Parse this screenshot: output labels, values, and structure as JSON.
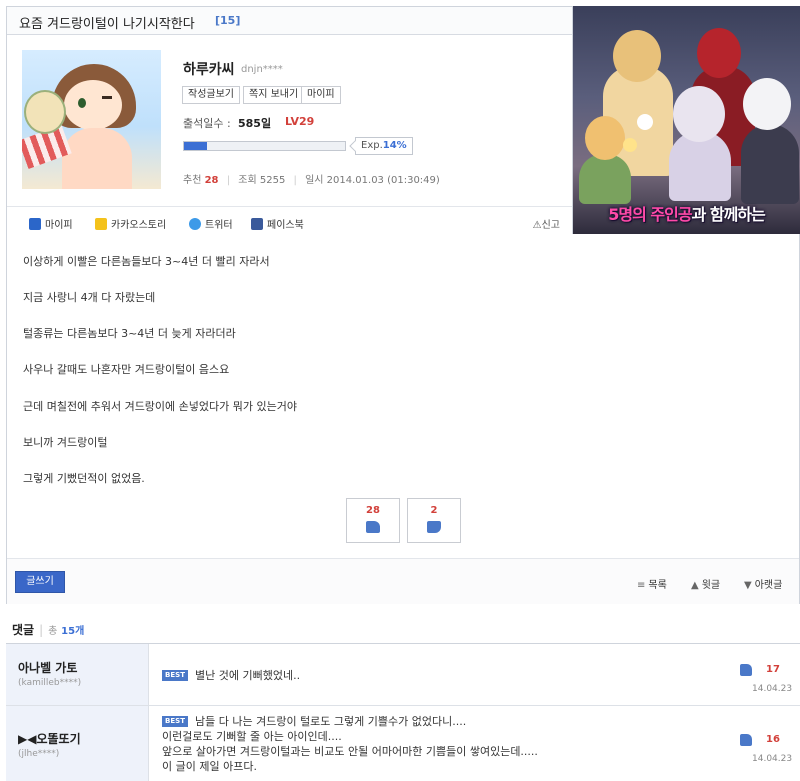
{
  "post": {
    "title": "요즘 겨드랑이털이 나기시작한다",
    "comment_count_badge": "[15]",
    "author": {
      "name": "하루카씨",
      "id": "dnjn****",
      "buttons": [
        "작성글보기",
        "쪽지 보내기",
        "마이피"
      ],
      "attendance_label": "출석일수 :",
      "attendance_value": "585일",
      "level": "LV29",
      "exp_label": "Exp.",
      "exp_percent": "14%",
      "exp_fraction": 0.14
    },
    "stats": {
      "recommend_label": "추천",
      "recommend_value": "28",
      "views_label": "조회",
      "views_value": "5255",
      "datetime_label": "일시",
      "datetime_value": "2014.01.03 (01:30:49)"
    },
    "share": {
      "mypi": "마이피",
      "kakao": "카카오스토리",
      "twitter": "트위터",
      "facebook": "페이스북",
      "report": "신고"
    },
    "body_lines": [
      "이상하게 이빨은 다른놈들보다 3~4년 더 빨리 자라서",
      "지금 사랑니 4개 다 자랐는데",
      "털종류는 다른놈보다 3~4년 더 늦게 자라더라",
      "사우나 갈때도 나혼자만 겨드랑이털이 음스요",
      "근데 며칠전에 추워서 겨드랑이에 손넣었다가 뭐가 있는거야",
      "보니까 겨드랑이털",
      "그렇게 기뻤던적이 없었음."
    ],
    "votes": {
      "up": "28",
      "down": "2"
    },
    "actions": {
      "write": "글쓰기",
      "list": "목록",
      "prev": "윗글",
      "next": "아랫글"
    }
  },
  "banner": {
    "text_highlight": "5명의 주인공",
    "text_rest": "과 함께하는"
  },
  "comments": {
    "title": "댓글",
    "total_label": "총",
    "total_value": "15개",
    "items": [
      {
        "name": "아나벨 가토",
        "id": "(kamilleb****)",
        "badge": "BEST",
        "lines": [
          "별난 것에 기뻐했었네.."
        ],
        "likes": "17",
        "date": "14.04.23"
      },
      {
        "name": "▶◀오똘또기",
        "id": "(jlhe****)",
        "badge": "BEST",
        "lines": [
          "남들 다 나는 겨드랑이 털로도 그렇게 기쁠수가 없었다니....",
          "이런걸로도 기뻐할 줄 아는 아이인데....",
          "앞으로 살아가면 겨드랑이털과는 비교도 안될 어마어마한 기쁨들이 쌓여있는데.....",
          "이 글이 제일 아프다."
        ],
        "likes": "16",
        "date": "14.04.23"
      }
    ]
  },
  "colors": {
    "accent": "#3b6fd4",
    "highlight_red": "#d2403a",
    "comment_sidebar": "#eef2fa"
  },
  "icons": {
    "mypi": "mypi-icon",
    "kakao": "kakaostory-icon",
    "twitter": "twitter-icon",
    "facebook": "facebook-icon",
    "report": "siren-icon",
    "thumb_up": "thumb-up-icon",
    "thumb_down": "thumb-down-icon"
  }
}
